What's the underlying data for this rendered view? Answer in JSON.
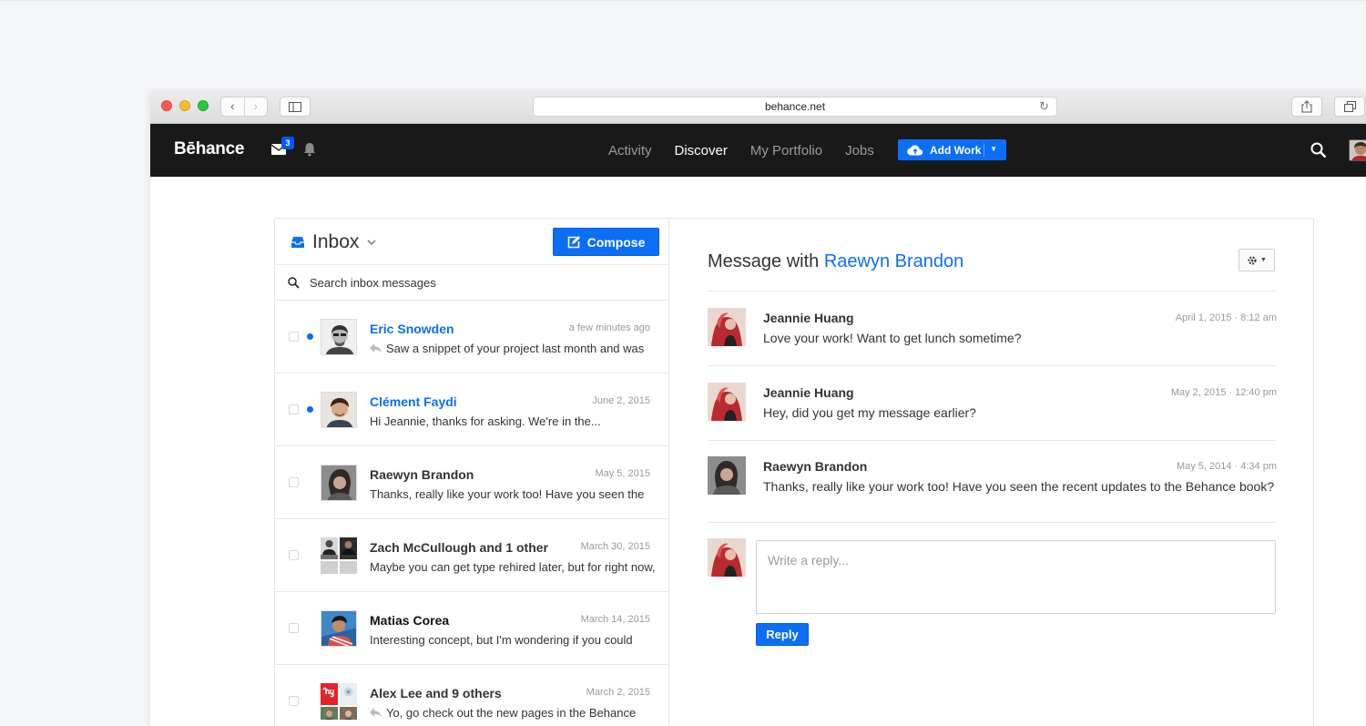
{
  "browser": {
    "url": "behance.net",
    "back_glyph": "‹",
    "forward_glyph": "›"
  },
  "nav": {
    "logo": "Bēhance",
    "mail_badge": "3",
    "links": [
      "Activity",
      "Discover",
      "My Portfolio",
      "Jobs"
    ],
    "active_link": "Discover",
    "add_work_label": "Add Work",
    "accent_color": "#0b6ef6"
  },
  "inbox": {
    "title": "Inbox",
    "compose_label": "Compose",
    "search_placeholder": "Search inbox messages",
    "threads": [
      {
        "name": "Eric Snowden",
        "date": "a few minutes ago",
        "snippet": "Saw a snippet of your project last month and was",
        "unread": true,
        "replied": true
      },
      {
        "name": "Clément Faydi",
        "date": "June 2, 2015",
        "snippet": "Hi Jeannie, thanks for asking. We're in the...",
        "unread": true,
        "replied": false
      },
      {
        "name": "Raewyn Brandon",
        "date": "May 5, 2015",
        "snippet": "Thanks, really like your work too! Have you seen the",
        "unread": false,
        "replied": false
      },
      {
        "name": "Zach McCullough and 1 other",
        "date": "March 30, 2015",
        "snippet": "Maybe you can get type rehired later, but for right now,",
        "unread": false,
        "replied": false
      },
      {
        "name": "Matias Corea",
        "date": "March 14, 2015",
        "snippet": "Interesting concept, but I'm wondering if you could",
        "unread": false,
        "replied": false
      },
      {
        "name": "Alex Lee and 9 others",
        "date": "March 2, 2015",
        "snippet": "Yo, go check out the new pages in the Behance",
        "unread": false,
        "replied": true
      }
    ]
  },
  "conversation": {
    "title_prefix": "Message with",
    "title_person": "Raewyn Brandon",
    "messages": [
      {
        "sender": "Jeannie Huang",
        "time": "April 1, 2015 ·  8:12 am",
        "text": "Love your work! Want to get lunch sometime?"
      },
      {
        "sender": "Jeannie Huang",
        "time": "May 2, 2015 ·  12:40 pm",
        "text": "Hey, did you get my message earlier?"
      },
      {
        "sender": "Raewyn Brandon",
        "time": "May 5, 2014 ·  4:34 pm",
        "text": "Thanks, really like your work too! Have you seen the recent updates to the Behance book?"
      }
    ],
    "reply_placeholder": "Write a reply...",
    "reply_label": "Reply"
  }
}
